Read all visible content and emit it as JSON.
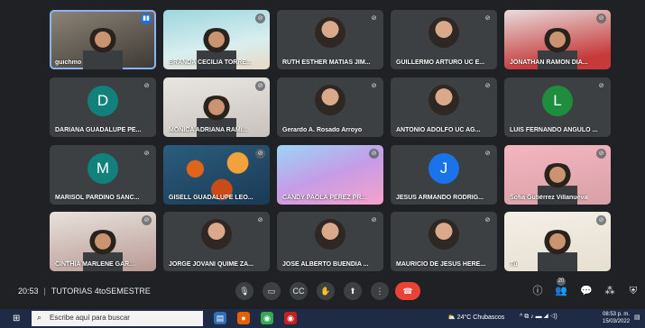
{
  "participants": [
    {
      "name": "guichmo",
      "speaking": true
    },
    {
      "name": "BRANDA CECILIA TORRE..."
    },
    {
      "name": "RUTH ESTHER MATIAS JIM..."
    },
    {
      "name": "GUILLERMO ARTURO UC E..."
    },
    {
      "name": "JONATHAN RAMON DIA..."
    },
    {
      "name": "DARIANA GUADALUPE PE...",
      "initial": "D",
      "color": "#12807b"
    },
    {
      "name": "MONICA ADRIANA RAMI..."
    },
    {
      "name": "Gerardo A. Rosado Arroyo"
    },
    {
      "name": "ANTONIO ADOLFO UC AG..."
    },
    {
      "name": "LUIS FERNANDO ANGULO ...",
      "initial": "L",
      "color": "#1e8e3e"
    },
    {
      "name": "MARISOL PARDIÑO SANC...",
      "initial": "M",
      "color": "#12807b"
    },
    {
      "name": "GISELL GUADALUPE LEO..."
    },
    {
      "name": "CANDY PAOLA PEREZ PR..."
    },
    {
      "name": "JESUS ARMANDO RODRIG...",
      "initial": "J",
      "color": "#1a73e8"
    },
    {
      "name": "Sofia Gutiérrez Villanueva"
    },
    {
      "name": "CINTHIA MARLENE GAR..."
    },
    {
      "name": "JORGE JOVANI QUIME ZA..."
    },
    {
      "name": "JOSE ALBERTO BUENDIA ..."
    },
    {
      "name": "MAURICIO DE JESUS HERE..."
    },
    {
      "name": "Tú"
    }
  ],
  "meeting": {
    "time": "20:53",
    "title": "TUTORIAS 4toSEMESTRE"
  },
  "people_count": "20",
  "taskbar": {
    "search_placeholder": "Escribe aquí para buscar",
    "weather": "24°C  Chubascos",
    "clock_time": "08:53 p. m.",
    "clock_date": "15/03/2022"
  }
}
